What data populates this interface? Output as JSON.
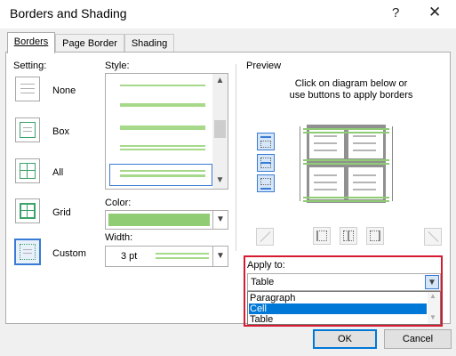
{
  "window": {
    "title": "Borders and Shading",
    "help_glyph": "?",
    "close_glyph": "✕"
  },
  "tabs": [
    {
      "label": "Borders",
      "active": true
    },
    {
      "label": "Page Border",
      "active": false
    },
    {
      "label": "Shading",
      "active": false
    }
  ],
  "setting": {
    "heading": "Setting:",
    "options": [
      {
        "label": "None",
        "selected": false
      },
      {
        "label": "Box",
        "selected": false
      },
      {
        "label": "All",
        "selected": false
      },
      {
        "label": "Grid",
        "selected": false
      },
      {
        "label": "Custom",
        "selected": true
      }
    ]
  },
  "style": {
    "heading": "Style:",
    "line_color": "#a6d98a",
    "selected_index": 4
  },
  "color": {
    "heading": "Color:",
    "value_color": "#8fcc74"
  },
  "width": {
    "heading": "Width:",
    "value": "3 pt"
  },
  "preview": {
    "heading": "Preview",
    "instruction_line1": "Click on diagram below or",
    "instruction_line2": "use buttons to apply borders"
  },
  "apply_to": {
    "heading": "Apply to:",
    "value": "Table",
    "options": [
      "Paragraph",
      "Cell",
      "Table"
    ],
    "highlighted": "Cell"
  },
  "buttons": {
    "ok": "OK",
    "cancel": "Cancel"
  },
  "colors": {
    "accent": "#0078d7",
    "highlight_red": "#d51a32",
    "border_green": "#8fcc74"
  }
}
